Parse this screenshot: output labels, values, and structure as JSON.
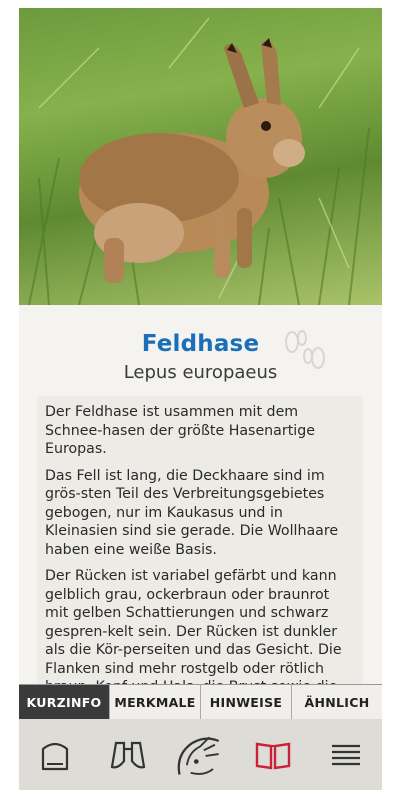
{
  "animal": {
    "name": "Feldhase",
    "latin": "Lepus europaeus",
    "paragraphs": [
      "Der Feldhase ist usammen mit dem Schnee-hasen der größte Hasenartige Europas.",
      "Das Fell ist lang, die Deckhaare sind im grös-sten Teil des Verbreitungsgebietes gebogen, nur im Kaukasus und in Kleinasien sind sie gerade. Die Wollhaare haben eine weiße Basis.",
      "Der Rücken ist variabel gefärbt und kann gelblich grau, ockerbraun oder braunrot mit gelben Schattierungen und schwarz gespren-kelt sein. Der Rücken ist dunkler als die Kör-perseiten und das Gesicht. Die Flanken sind mehr rostgelb oder rötlich braun. Kopf und Hals, die Brust sowie die Beine sind"
    ]
  },
  "tabs": [
    {
      "label": "KURZINFO",
      "active": true
    },
    {
      "label": "MERKMALE",
      "active": false
    },
    {
      "label": "HINWEISE",
      "active": false
    },
    {
      "label": "ÄHNLICH",
      "active": false
    }
  ],
  "bottom_nav": [
    {
      "icon": "home-icon"
    },
    {
      "icon": "binoculars-icon"
    },
    {
      "icon": "hedgehog-logo-icon"
    },
    {
      "icon": "book-icon",
      "active": true
    },
    {
      "icon": "menu-icon"
    }
  ],
  "colors": {
    "title": "#1b6fb8",
    "active_tab": "#3a3a3a",
    "active_nav": "#c8223a"
  }
}
